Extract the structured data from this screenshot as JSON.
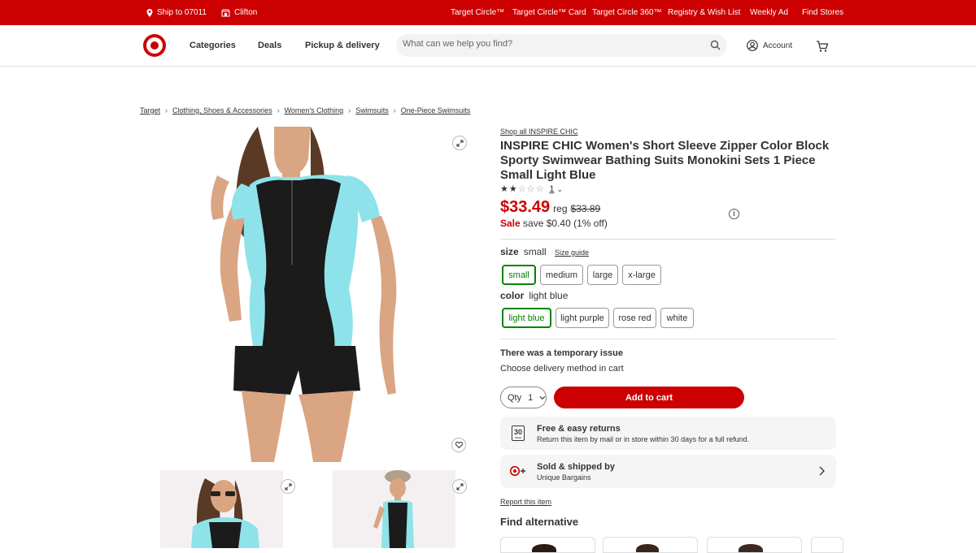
{
  "topbar": {
    "ship_to": "Ship to 07011",
    "store": "Clifton",
    "links": [
      "Target Circle™",
      "Target Circle™ Card",
      "Target Circle 360™",
      "Registry & Wish List",
      "Weekly Ad",
      "Find Stores"
    ]
  },
  "nav": {
    "categories": "Categories",
    "deals": "Deals",
    "pickup": "Pickup & delivery",
    "search_placeholder": "What can we help you find?",
    "account": "Account"
  },
  "breadcrumb": [
    "Target",
    "Clothing, Shoes & Accessories",
    "Women's Clothing",
    "Swimsuits",
    "One-Piece Swimsuits"
  ],
  "product": {
    "shop_all": "Shop all INSPIRE CHIC",
    "title": "INSPIRE CHIC Women's Short Sleeve Zipper Color Block Sporty Swimwear Bathing Suits Monokini Sets 1 Piece Small Light Blue",
    "rating_stars": 2,
    "rating_count": "1",
    "price": "$33.49",
    "reg_label": "reg",
    "reg_price": "$33.89",
    "sale_label": "Sale",
    "savings": "save $0.40 (1% off)"
  },
  "size": {
    "label": "size",
    "selected": "small",
    "guide": "Size guide",
    "options": [
      "small",
      "medium",
      "large",
      "x-large"
    ]
  },
  "color": {
    "label": "color",
    "selected": "light blue",
    "options": [
      "light blue",
      "light purple",
      "rose red",
      "white"
    ]
  },
  "fulfillment": {
    "issue": "There was a temporary issue",
    "choose": "Choose delivery method in cart"
  },
  "purchase": {
    "qty_label": "Qty",
    "qty_value": "1",
    "add_to_cart": "Add to cart"
  },
  "returns": {
    "badge_number": "30",
    "badge_text": "days",
    "title": "Free & easy returns",
    "text": "Return this item by mail or in store within 30 days for a full refund."
  },
  "seller": {
    "title": "Sold & shipped by",
    "name": "Unique Bargains"
  },
  "report": "Report this item",
  "find_alternative": "Find alternative",
  "colors": {
    "brand_red": "#cc0000",
    "selected_green": "#008300",
    "swim_teal": "#8ee3ea",
    "swim_black": "#1b1b1b"
  }
}
